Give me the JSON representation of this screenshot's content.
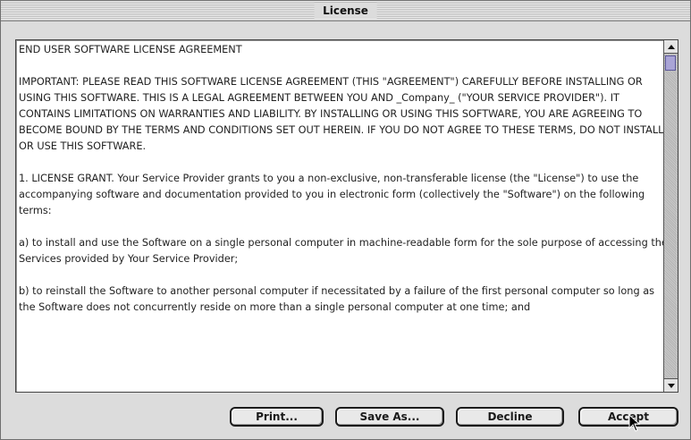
{
  "window": {
    "title": "License"
  },
  "license": {
    "heading": "END USER SOFTWARE LICENSE AGREEMENT",
    "paragraphs": [
      "IMPORTANT: PLEASE READ THIS SOFTWARE LICENSE AGREEMENT (THIS \"AGREEMENT\") CAREFULLY BEFORE INSTALLING OR USING THIS SOFTWARE. THIS IS A LEGAL AGREEMENT BETWEEN YOU AND _Company_ (\"YOUR SERVICE PROVIDER\"). IT CONTAINS LIMITATIONS ON WARRANTIES AND LIABILITY. BY INSTALLING OR USING THIS SOFTWARE, YOU ARE AGREEING TO BECOME BOUND BY THE TERMS AND CONDITIONS SET OUT HEREIN. IF YOU DO NOT AGREE TO THESE TERMS, DO NOT INSTALL OR USE THIS SOFTWARE.",
      "1. LICENSE GRANT. Your Service Provider grants to you a non-exclusive, non-transferable license (the \"License\") to use the accompanying software and documentation provided to you in electronic form (collectively the \"Software\") on the following terms:",
      "a) to install and use the Software on a single personal computer in machine-readable form for the sole purpose of accessing the Services provided by Your Service Provider;",
      "b) to reinstall the Software to another personal computer if necessitated by a failure of the first personal computer so long as the Software does not concurrently reside on more than a single personal computer at one time; and"
    ]
  },
  "buttons": {
    "print": "Print...",
    "save_as": "Save As...",
    "decline": "Decline",
    "accept": "Accept"
  },
  "scrollbar": {
    "position": 0
  },
  "icons": {
    "scroll_up": "up-arrow-icon",
    "scroll_down": "down-arrow-icon",
    "cursor": "mouse-pointer-icon"
  },
  "colors": {
    "scroll_thumb": "#a9a4d6",
    "window_bg": "#dcdcdc"
  }
}
